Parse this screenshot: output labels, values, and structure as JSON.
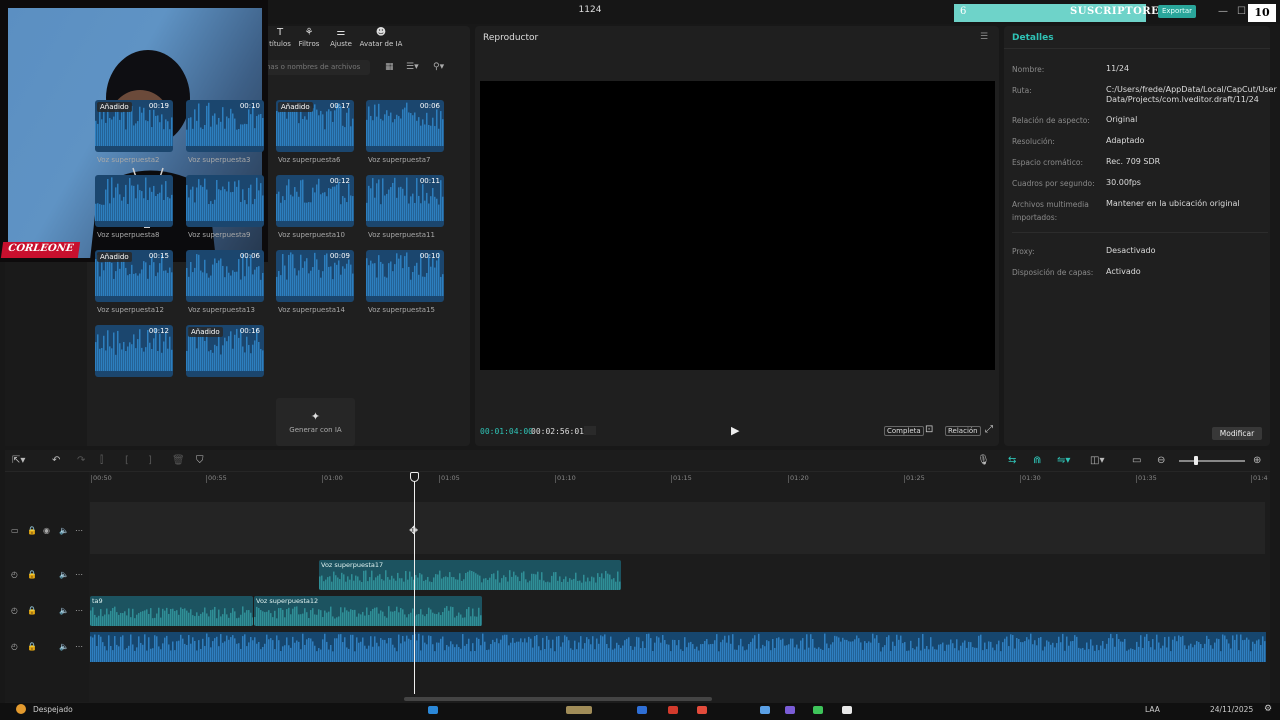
{
  "window": {
    "title": "1124",
    "controls": [
      "—",
      "☐",
      "✕"
    ]
  },
  "overlay": {
    "subs_left": "6",
    "subs_label": "SUSCRIPTORES",
    "subs_count": "10",
    "export_label": "Exportar",
    "cam_tag": "CORLEONE"
  },
  "media": {
    "tabs": [
      {
        "label": "títulos",
        "icon": "text-icon"
      },
      {
        "label": "Filtros",
        "icon": "filter-icon"
      },
      {
        "label": "Ajuste",
        "icon": "adjust-icon"
      },
      {
        "label": "Avatar de IA",
        "icon": "avatar-icon"
      }
    ],
    "search_placeholder": "nas o nombres de archivos",
    "clips": [
      {
        "label": "Voz superpuesta2",
        "duration": "00:19",
        "added": "Añadido"
      },
      {
        "label": "Voz superpuesta3",
        "duration": "00:10",
        "added": ""
      },
      {
        "label": "Voz superpuesta6",
        "duration": "00:17",
        "added": "Añadido"
      },
      {
        "label": "Voz superpuesta7",
        "duration": "00:06",
        "added": ""
      },
      {
        "label": "Voz superpuesta8",
        "duration": "",
        "added": ""
      },
      {
        "label": "Voz superpuesta9",
        "duration": "",
        "added": ""
      },
      {
        "label": "Voz superpuesta10",
        "duration": "00:12",
        "added": ""
      },
      {
        "label": "Voz superpuesta11",
        "duration": "00:11",
        "added": ""
      },
      {
        "label": "Voz superpuesta12",
        "duration": "00:15",
        "added": "Añadido"
      },
      {
        "label": "Voz superpuesta13",
        "duration": "00:06",
        "added": ""
      },
      {
        "label": "Voz superpuesta14",
        "duration": "00:09",
        "added": ""
      },
      {
        "label": "Voz superpuesta15",
        "duration": "00:10",
        "added": ""
      },
      {
        "label": "",
        "duration": "00:12",
        "added": ""
      },
      {
        "label": "",
        "duration": "00:16",
        "added": "Añadido"
      }
    ],
    "generate_label": "Generar con IA"
  },
  "player": {
    "title": "Reproductor",
    "current_time": "00:01:04:00",
    "total_time": "00:02:56:01",
    "btn_full": "Completa",
    "btn_ratio": "Relación"
  },
  "details": {
    "title": "Detalles",
    "rows": [
      {
        "label": "Nombre:",
        "value": "11/24"
      },
      {
        "label": "Ruta:",
        "value": "C:/Users/frede/AppData/Local/CapCut/User Data/Projects/com.lveditor.draft/11/24"
      },
      {
        "label": "Relación de aspecto:",
        "value": "Original"
      },
      {
        "label": "Resolución:",
        "value": "Adaptado"
      },
      {
        "label": "Espacio cromático:",
        "value": "Rec. 709 SDR"
      },
      {
        "label": "Cuadros por segundo:",
        "value": "30.00fps"
      },
      {
        "label": "Archivos multimedia importados:",
        "value": "Mantener en la ubicación original"
      },
      {
        "label": "Proxy:",
        "value": "Desactivado"
      },
      {
        "label": "Disposición de capas:",
        "value": "Activado"
      }
    ],
    "modify_label": "Modificar"
  },
  "timeline": {
    "ticks": [
      "00:50",
      "00:55",
      "01:00",
      "01:05",
      "01:10",
      "01:15",
      "01:20",
      "01:25",
      "01:30",
      "01:35",
      "01:4"
    ],
    "clips": [
      {
        "label": "Voz superpuesta17"
      },
      {
        "label": "ta9"
      },
      {
        "label": "Voz superpuesta12"
      }
    ]
  },
  "taskbar": {
    "weather": "Despejado",
    "lang": "LAA",
    "date": "24/11/2025"
  },
  "colors": {
    "accent": "#2fc3b6",
    "clip_blue": "#1b466e",
    "audio_clip": "#1c5360",
    "brand_red": "#c8102e"
  }
}
